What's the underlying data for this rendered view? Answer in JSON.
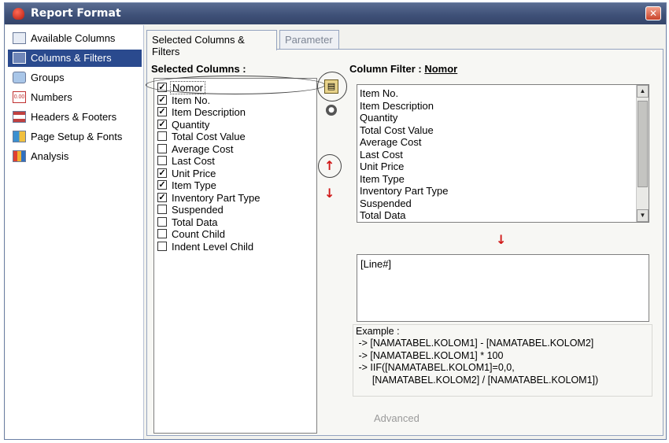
{
  "window": {
    "title": "Report Format",
    "close_label": "✕"
  },
  "sidebar": {
    "items": [
      {
        "label": "Available Columns",
        "icon": "page-icon"
      },
      {
        "label": "Columns & Filters",
        "icon": "columns-icon",
        "active": true
      },
      {
        "label": "Groups",
        "icon": "groups-icon"
      },
      {
        "label": "Numbers",
        "icon": "numbers-icon"
      },
      {
        "label": "Headers & Footers",
        "icon": "headers-icon"
      },
      {
        "label": "Page Setup & Fonts",
        "icon": "page-setup-icon"
      },
      {
        "label": "Analysis",
        "icon": "analysis-icon"
      }
    ]
  },
  "tabs": [
    {
      "label": "Selected Columns & Filters",
      "active": true
    },
    {
      "label": "Parameter",
      "active": false
    }
  ],
  "selected_columns": {
    "header": "Selected Columns :",
    "items": [
      {
        "label": "Nomor",
        "checked": true,
        "selected": true
      },
      {
        "label": "Item No.",
        "checked": true
      },
      {
        "label": "Item Description",
        "checked": true
      },
      {
        "label": "Quantity",
        "checked": true
      },
      {
        "label": "Total Cost Value",
        "checked": false
      },
      {
        "label": "Average Cost",
        "checked": false
      },
      {
        "label": "Last Cost",
        "checked": false
      },
      {
        "label": "Unit Price",
        "checked": true
      },
      {
        "label": "Item Type",
        "checked": true
      },
      {
        "label": "Inventory Part Type",
        "checked": true
      },
      {
        "label": "Suspended",
        "checked": false
      },
      {
        "label": "Total Data",
        "checked": false
      },
      {
        "label": "Count Child",
        "checked": false
      },
      {
        "label": "Indent Level Child",
        "checked": false
      }
    ]
  },
  "column_filter": {
    "header_prefix": "Column Filter :",
    "header_column": "Nomor",
    "items": [
      "Item No.",
      "Item Description",
      "Quantity",
      "Total Cost Value",
      "Average Cost",
      "Last Cost",
      "Unit Price",
      "Item Type",
      "Inventory Part Type",
      "Suspended",
      "Total Data"
    ],
    "expression": "[Line#]"
  },
  "example": {
    "title": "Example :",
    "lines": [
      " -> [NAMATABEL.KOLOM1] - [NAMATABEL.KOLOM2]",
      " -> [NAMATABEL.KOLOM1] * 100",
      " -> IIF([NAMATABEL.KOLOM1]=0,0,",
      "      [NAMATABEL.KOLOM2] / [NAMATABEL.KOLOM1])"
    ]
  },
  "advanced_label": "Advanced",
  "colors": {
    "titlebar": "#3f5178",
    "sidebar_active": "#2a4a8e",
    "arrow": "#d01818"
  }
}
